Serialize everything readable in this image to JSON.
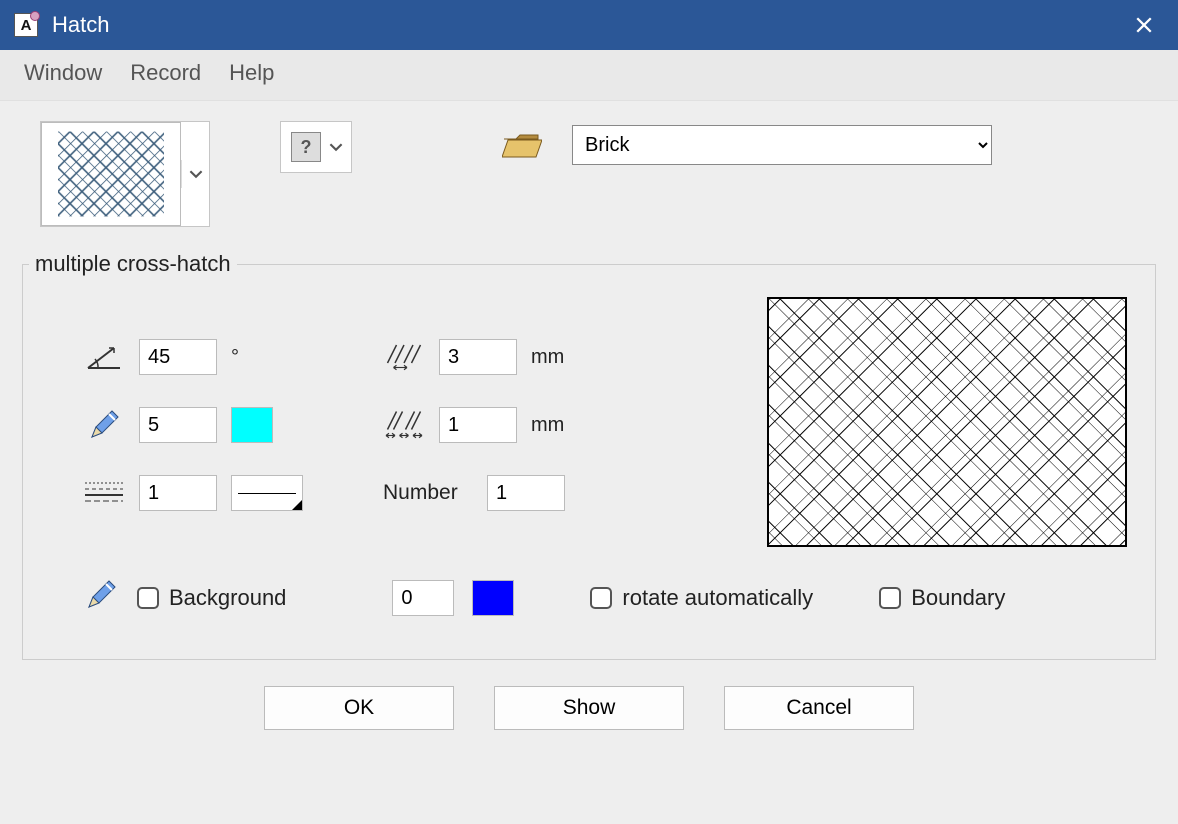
{
  "window": {
    "title": "Hatch",
    "app_icon_letter": "A"
  },
  "menu": {
    "window": "Window",
    "record": "Record",
    "help": "Help"
  },
  "toolbar": {
    "help_symbol": "?",
    "pattern_select": "Brick"
  },
  "fieldset": {
    "legend": "multiple cross-hatch"
  },
  "params": {
    "angle_value": "45",
    "angle_unit": "°",
    "pen_value": "5",
    "pen_color": "#00FFFF",
    "linetype_value": "1",
    "distance_value": "3",
    "distance_unit": "mm",
    "spacing_value": "1",
    "spacing_unit": "mm",
    "number_label": "Number",
    "number_value": "1"
  },
  "options": {
    "background_label": "Background",
    "background_value": "0",
    "background_color": "#0000FF",
    "rotate_label": "rotate automatically",
    "boundary_label": "Boundary"
  },
  "buttons": {
    "ok": "OK",
    "show": "Show",
    "cancel": "Cancel"
  }
}
